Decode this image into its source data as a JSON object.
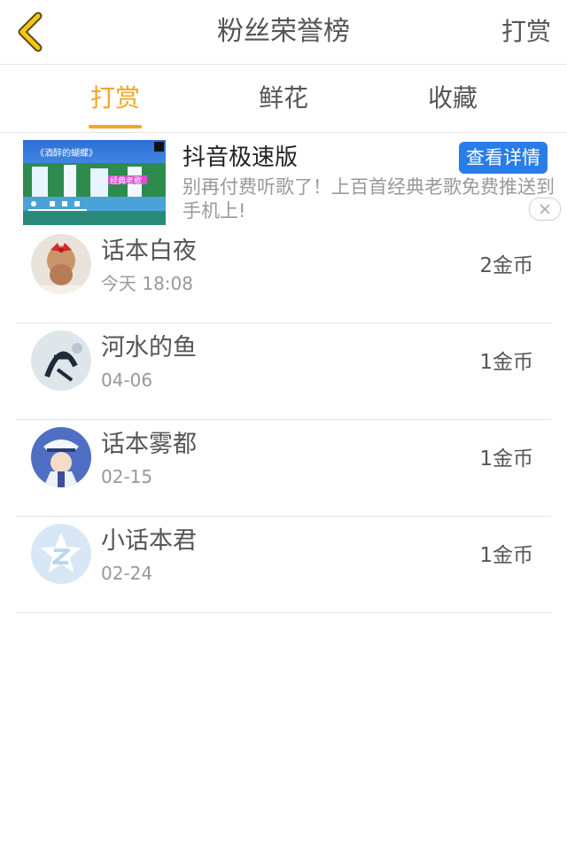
{
  "header": {
    "title": "粉丝荣誉榜",
    "action_label": "打赏"
  },
  "tabs": [
    {
      "label": "打赏",
      "active": true
    },
    {
      "label": "鲜花",
      "active": false
    },
    {
      "label": "收藏",
      "active": false
    }
  ],
  "ad": {
    "title": "抖音极速版",
    "button_label": "查看详情",
    "description": "别再付费听歌了！上百首经典老歌免费推送到手机上!",
    "thumbnail_caption": "《酒醉的蝴蝶》",
    "thumbnail_subcaption": "经典老歌"
  },
  "fans": [
    {
      "name": "话本白夜",
      "time": "今天 18:08",
      "amount": "2金币"
    },
    {
      "name": "河水的鱼",
      "time": "04-06",
      "amount": "1金币"
    },
    {
      "name": "话本雾都",
      "time": "02-15",
      "amount": "1金币"
    },
    {
      "name": "小话本君",
      "time": "02-24",
      "amount": "1金币"
    }
  ],
  "colors": {
    "accent": "#f5a623",
    "ad_button": "#2a7de8"
  }
}
